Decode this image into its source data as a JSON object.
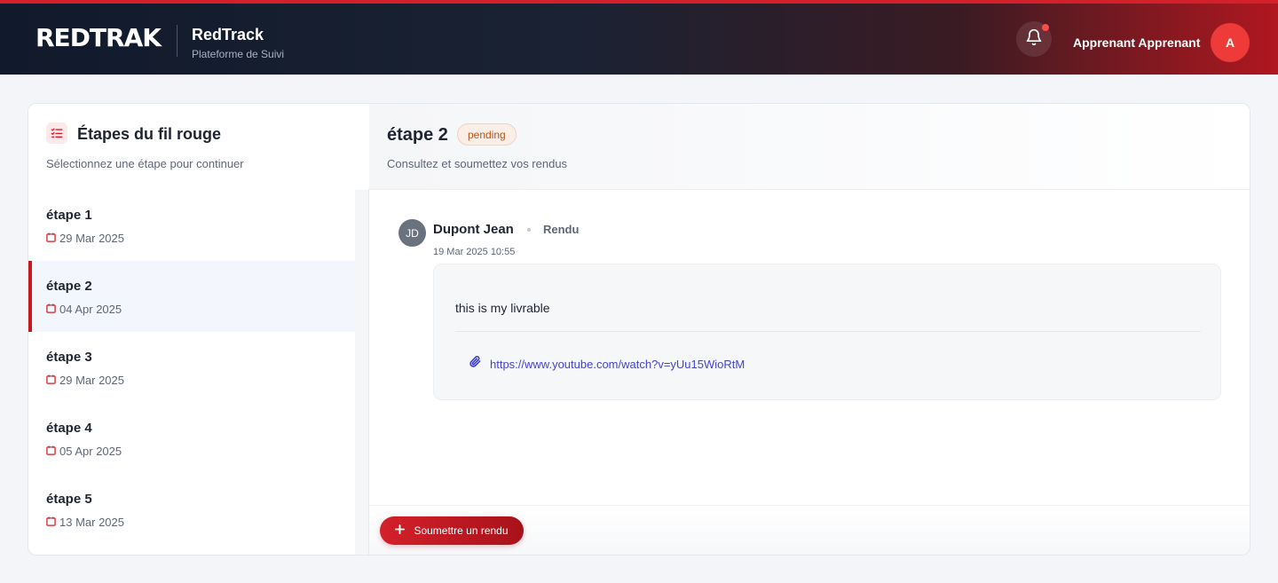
{
  "header": {
    "logo_text_1": "REDT",
    "logo_text_2": "RAK",
    "brand_name": "RedTrack",
    "brand_subtitle": "Plateforme de Suivi",
    "user_name": "Apprenant Apprenant",
    "user_initial": "A",
    "notification_icon": "bell-icon",
    "has_notification": true
  },
  "steps_panel": {
    "title": "Étapes du fil rouge",
    "subtitle": "Sélectionnez une étape pour continuer",
    "items": [
      {
        "name": "étape 1",
        "date": "29 Mar 2025",
        "active": false
      },
      {
        "name": "étape 2",
        "date": "04 Apr 2025",
        "active": true
      },
      {
        "name": "étape 3",
        "date": "29 Mar 2025",
        "active": false
      },
      {
        "name": "étape 4",
        "date": "05 Apr 2025",
        "active": false
      },
      {
        "name": "étape 5",
        "date": "13 Mar 2025",
        "active": false
      }
    ]
  },
  "detail": {
    "title": "étape 2",
    "status": "pending",
    "subtitle": "Consultez et soumettez vos rendus",
    "submission": {
      "initials": "JD",
      "author": "Dupont Jean",
      "status": "Rendu",
      "timestamp": "19 Mar 2025 10:55",
      "text": "this is my livrable",
      "link": "https://www.youtube.com/watch?v=yUu15WioRtM"
    },
    "submit_button": "Soumettre un rendu"
  },
  "colors": {
    "accent": "#d4202a",
    "link": "#4444cc",
    "pending_text": "#b4561f",
    "pending_bg": "#fbeee6"
  }
}
